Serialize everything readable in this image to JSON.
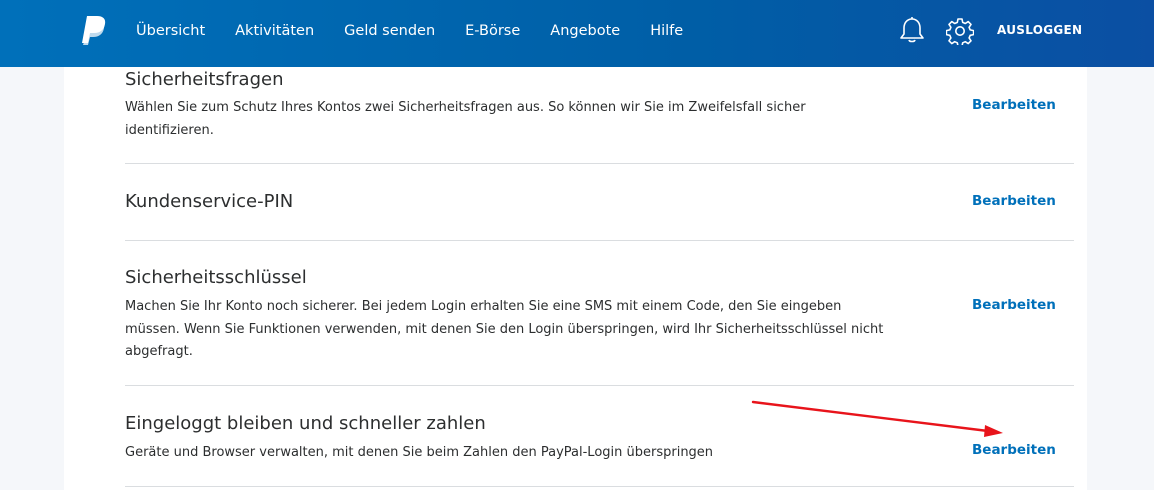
{
  "header": {
    "nav": [
      "Übersicht",
      "Aktivitäten",
      "Geld senden",
      "E-Börse",
      "Angebote",
      "Hilfe"
    ],
    "logout_label": "AUSLOGGEN",
    "icons": [
      "paypal-logo",
      "bell-icon",
      "gear-icon"
    ],
    "brand_color": "#0070ba"
  },
  "sections": [
    {
      "title": "Sicherheitsfragen",
      "desc_lines": [
        "Wählen Sie zum Schutz Ihres Kontos zwei Sicherheitsfragen aus. So können wir Sie im Zweifelsfall sicher",
        "identifizieren."
      ],
      "action": "Bearbeiten"
    },
    {
      "title": "Kundenservice-PIN",
      "desc_lines": [],
      "action": "Bearbeiten"
    },
    {
      "title": "Sicherheitsschlüssel",
      "desc_lines": [
        "Machen Sie Ihr Konto noch sicherer. Bei jedem Login erhalten Sie eine SMS mit einem Code, den Sie eingeben",
        "müssen. Wenn Sie Funktionen verwenden, mit denen Sie den Login überspringen, wird Ihr Sicherheitsschlüssel nicht",
        "abgefragt."
      ],
      "action": "Bearbeiten"
    },
    {
      "title": "Eingeloggt bleiben und schneller zahlen",
      "desc_lines": [
        "Geräte und Browser verwalten, mit denen Sie beim Zahlen den PayPal-Login überspringen"
      ],
      "action": "Bearbeiten"
    }
  ],
  "annotation": {
    "type": "red-arrow",
    "color": "#e8141b"
  }
}
